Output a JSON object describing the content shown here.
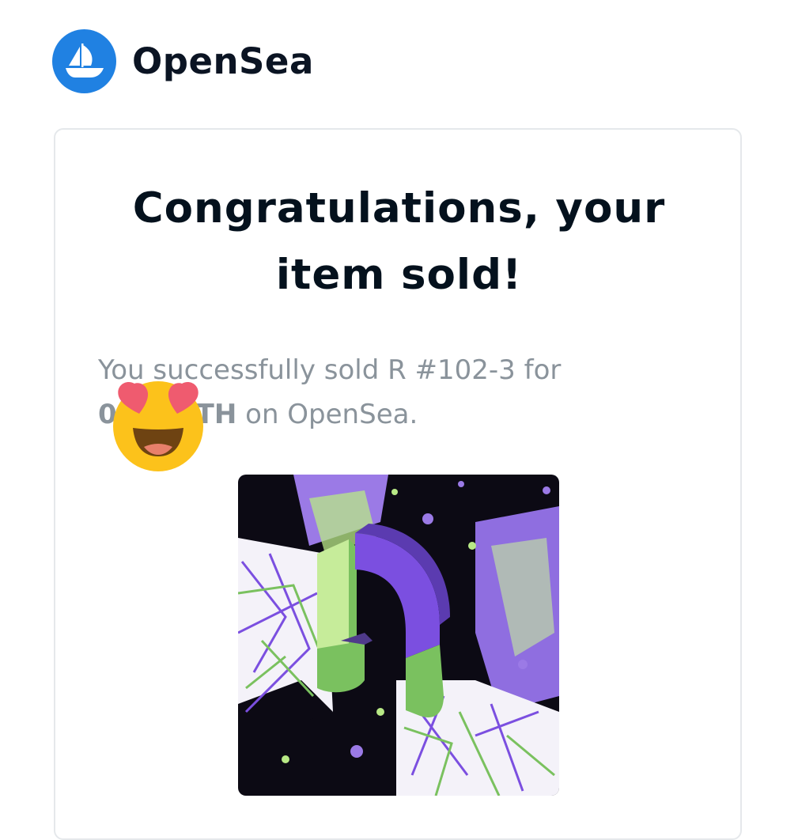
{
  "brand": {
    "name": "OpenSea",
    "logo_icon": "opensea-boat-icon",
    "accent": "#2081e2"
  },
  "email": {
    "title_line1": "Congratulations, your",
    "title_line2": "item sold!",
    "desc_prefix": "You successfully sold R #102-3 for",
    "desc_price": "0.___ ETH",
    "desc_price_visible_start": "0",
    "desc_price_visible_end": "TH",
    "desc_suffix": "on OpenSea.",
    "overlay_emoji": "heart-eyes-emoji",
    "nft_image": "nft-artwork-r-102-3"
  },
  "colors": {
    "purple": "#7b4fe0",
    "lime": "#b8e986",
    "green": "#7ac15f",
    "dark": "#0c0a14"
  }
}
